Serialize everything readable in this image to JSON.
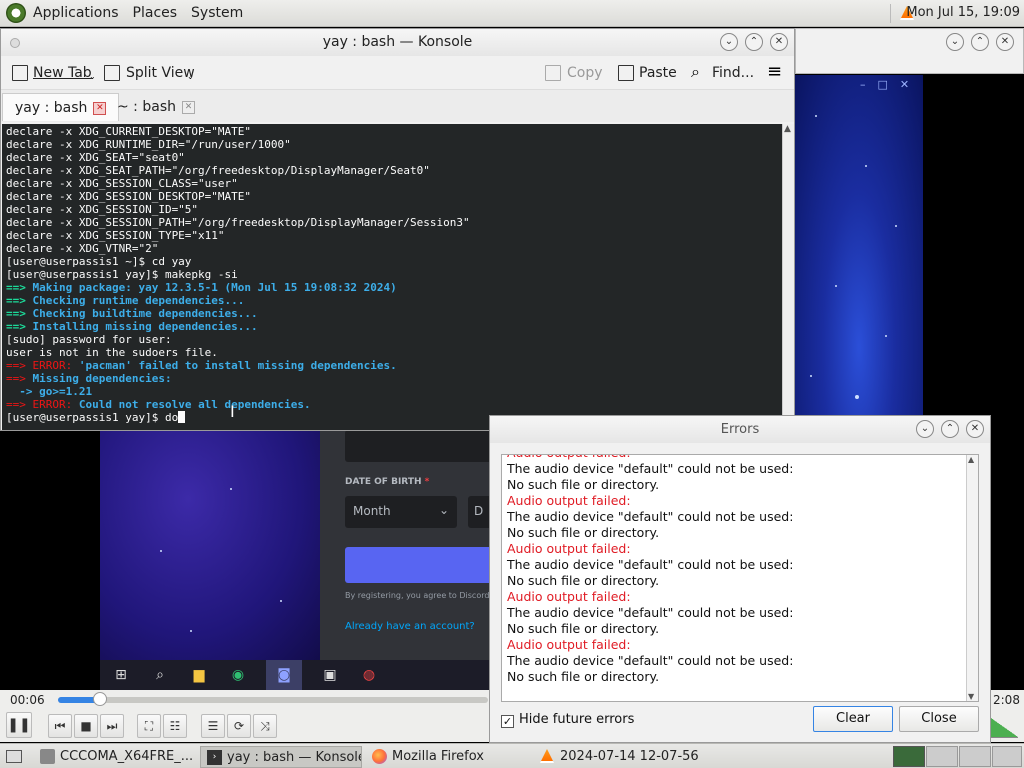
{
  "top_panel": {
    "menus": [
      "Applications",
      "Places",
      "System"
    ],
    "clock": "Mon Jul 15, 19:09"
  },
  "konsole": {
    "title": "yay : bash — Konsole",
    "toolbar": {
      "new_tab": "New Tab",
      "split_view": "Split View",
      "copy": "Copy",
      "paste": "Paste",
      "find": "Find..."
    },
    "tabs": [
      {
        "label": "yay : bash"
      },
      {
        "label": "~ : bash"
      }
    ],
    "terminal_lines": [
      {
        "t": "declare -x XDG_CURRENT_DESKTOP=\"MATE\"",
        "c": ""
      },
      {
        "t": "declare -x XDG_RUNTIME_DIR=\"/run/user/1000\"",
        "c": ""
      },
      {
        "t": "declare -x XDG_SEAT=\"seat0\"",
        "c": ""
      },
      {
        "t": "declare -x XDG_SEAT_PATH=\"/org/freedesktop/DisplayManager/Seat0\"",
        "c": ""
      },
      {
        "t": "declare -x XDG_SESSION_CLASS=\"user\"",
        "c": ""
      },
      {
        "t": "declare -x XDG_SESSION_DESKTOP=\"MATE\"",
        "c": ""
      },
      {
        "t": "declare -x XDG_SESSION_ID=\"5\"",
        "c": ""
      },
      {
        "t": "declare -x XDG_SESSION_PATH=\"/org/freedesktop/DisplayManager/Session3\"",
        "c": ""
      },
      {
        "t": "declare -x XDG_SESSION_TYPE=\"x11\"",
        "c": ""
      },
      {
        "t": "declare -x XDG_VTNR=\"2\"",
        "c": ""
      },
      {
        "t": "[user@userpassis1 ~]$ cd yay",
        "c": ""
      },
      {
        "t": "[user@userpassis1 yay]$ makepkg -si",
        "c": ""
      },
      {
        "p": "==>",
        "pc": "g",
        "t": " Making package: yay 12.3.5-1 (Mon Jul 15 19:08:32 2024)",
        "c": "b"
      },
      {
        "p": "==>",
        "pc": "g",
        "t": " Checking runtime dependencies...",
        "c": "b"
      },
      {
        "p": "==>",
        "pc": "g",
        "t": " Checking buildtime dependencies...",
        "c": "b"
      },
      {
        "p": "==>",
        "pc": "g",
        "t": " Installing missing dependencies...",
        "c": "b"
      },
      {
        "t": "[sudo] password for user:",
        "c": ""
      },
      {
        "t": "user is not in the sudoers file.",
        "c": ""
      },
      {
        "p": "==> ERROR:",
        "pc": "r",
        "t": " 'pacman' failed to install missing dependencies.",
        "c": "b"
      },
      {
        "p": "==>",
        "pc": "r",
        "t": " Missing dependencies:",
        "c": "b"
      },
      {
        "t": "  -> go>=1.21",
        "c": "b"
      },
      {
        "p": "==> ERROR:",
        "pc": "r",
        "t": " Could not resolve all dependencies.",
        "c": "b"
      },
      {
        "t": "[user@userpassis1 yay]$ do",
        "c": "",
        "cursor": true
      }
    ]
  },
  "discord": {
    "dob_label": "DATE OF BIRTH",
    "month": "Month",
    "day": "D",
    "terms": "By registering, you agree to Discord",
    "already": "Already have an account?"
  },
  "vlc": {
    "time_elapsed": "00:06",
    "time_total": "2:08",
    "progress_fraction": 0.1
  },
  "errors_dialog": {
    "title": "Errors",
    "lines": [
      {
        "t": "Audio output failed:",
        "red": true
      },
      {
        "t": "The audio device \"default\" could not be used:",
        "red": false
      },
      {
        "t": "No such file or directory.",
        "red": false
      },
      {
        "t": "Audio output failed:",
        "red": true
      },
      {
        "t": "The audio device \"default\" could not be used:",
        "red": false
      },
      {
        "t": "No such file or directory.",
        "red": false
      },
      {
        "t": "Audio output failed:",
        "red": true
      },
      {
        "t": "The audio device \"default\" could not be used:",
        "red": false
      },
      {
        "t": "No such file or directory.",
        "red": false
      },
      {
        "t": "Audio output failed:",
        "red": true
      },
      {
        "t": "The audio device \"default\" could not be used:",
        "red": false
      },
      {
        "t": "No such file or directory.",
        "red": false
      },
      {
        "t": "Audio output failed:",
        "red": true
      },
      {
        "t": "The audio device \"default\" could not be used:",
        "red": false
      },
      {
        "t": "No such file or directory.",
        "red": false
      }
    ],
    "hide_future": "Hide future errors",
    "clear": "Clear",
    "close": "Close"
  },
  "bottom_panel": {
    "tasks": [
      {
        "label": "CCCOMA_X64FRE_...",
        "icon": "folder-icon"
      },
      {
        "label": "yay : bash — Konsole",
        "icon": "terminal-icon",
        "active": true
      },
      {
        "label": "Mozilla Firefox",
        "icon": "firefox-icon"
      },
      {
        "label": "2024-07-14 12-07-56....",
        "icon": "vlc-icon"
      }
    ]
  },
  "colors": {
    "terminal_bg": "#232627",
    "prompt_green": "#1cdc9a",
    "info_blue": "#3daee9",
    "error_red": "#ed1515",
    "discord_blurple": "#5865f2"
  }
}
